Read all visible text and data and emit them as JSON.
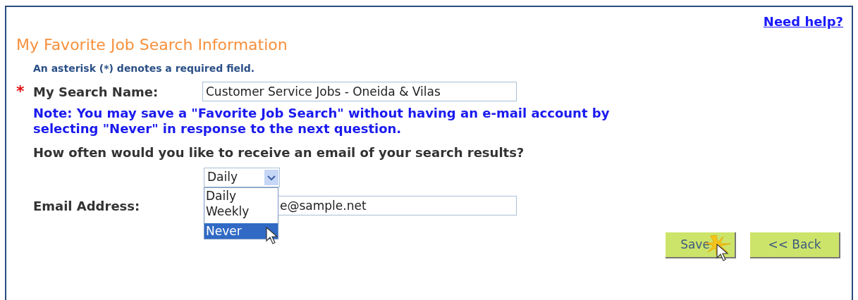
{
  "help_link": "Need help?",
  "title": "My Favorite Job Search Information",
  "required_note": "An asterisk (*) denotes a required field.",
  "search_name": {
    "required_mark": "*",
    "label": "My Search Name:",
    "value": "Customer Service Jobs - Oneida & Vilas"
  },
  "note": "Note: You may save a \"Favorite Job Search\" without having an e-mail account by selecting \"Never\" in response to the next question.",
  "question": "How often would you like to receive an email of your search results?",
  "frequency": {
    "value": "Daily",
    "expanded": true,
    "options": [
      {
        "label": "Daily",
        "highlighted": false
      },
      {
        "label": "Weekly",
        "highlighted": false
      },
      {
        "label": "Never",
        "highlighted": true
      }
    ]
  },
  "email": {
    "label": "Email Address:",
    "value": "e@sample.net"
  },
  "buttons": [
    {
      "label": "Save"
    },
    {
      "label": "<< Back"
    }
  ]
}
